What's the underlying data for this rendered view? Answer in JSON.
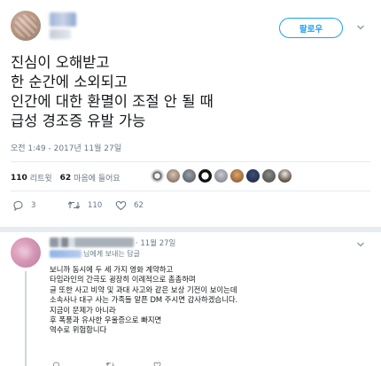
{
  "tweet": {
    "follow_label": "팔로우",
    "lines": [
      "진심이 오해받고",
      "한 순간에 소외되고",
      "인간에 대한 환멸이 조절 안 될 때",
      "급성 경조증 유발 가능"
    ],
    "timestamp": "오전 1:49 - 2017년 11월 27일",
    "stats": {
      "retweets_count": "110",
      "retweets_label": "리트윗",
      "likes_count": "62",
      "likes_label": "마음에 들어요"
    },
    "actions": {
      "reply_count": "3",
      "retweet_count": "110",
      "like_count": "62"
    },
    "colors": {
      "accent": "#1da1f2",
      "muted": "#657786",
      "divider": "#e6ecf0"
    }
  },
  "reply": {
    "date": "· 11월 27일",
    "to_suffix": "님에게 보내는 답글",
    "lines": [
      "보니까 동시에 두 세 가지 영화 계약하고",
      "타임라인의 간극도 굉장히 이례적으로 촘촘하며",
      "글 또한 사고 비약 및 과대 사고와 같은 보상 기전이 보이는데",
      "소속사나 대구 사는 가족들 알픈 DM 주시면 감사하겠습니다.",
      "지금이 문제가 아니라",
      "후 폭풍과 유사한 우울증으로 빠지면",
      "역수로 위험합니다"
    ]
  },
  "icons": [
    "chevron-down-icon",
    "reply-icon",
    "retweet-icon",
    "heart-icon"
  ]
}
